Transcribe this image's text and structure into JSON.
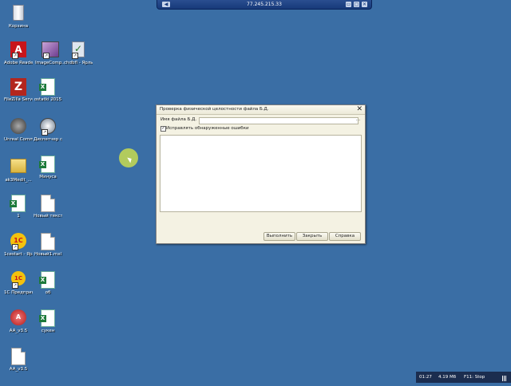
{
  "remote_bar": {
    "host": "77.245.215.33",
    "pin": "◀",
    "min": "▭",
    "restore": "▢",
    "close": "✕"
  },
  "desktop_icons": [
    {
      "label": "Корзина"
    },
    {
      "label": "Adobe Reader 9"
    },
    {
      "label": "ImageComp..."
    },
    {
      "label": "chdbfl - Ярлык"
    },
    {
      "label": "FileZilla Server Interface"
    },
    {
      "label": "ostatki 2015"
    },
    {
      "label": "Unreal Commander"
    },
    {
      "label": "Диспетчер служб у..."
    },
    {
      "label": "ak3Medit_..."
    },
    {
      "label": "Минуса"
    },
    {
      "label": "1"
    },
    {
      "label": "Новый текстов..."
    },
    {
      "label": "1cestart - Ярлык"
    },
    {
      "label": "Новый1.mxl"
    },
    {
      "label": "1С Предприятие"
    },
    {
      "label": "об"
    },
    {
      "label": "AA_v3.5"
    },
    {
      "label": "сукен"
    },
    {
      "label": "AA_v3.5"
    }
  ],
  "dialog": {
    "title": "Проверка физической целостности файла Б.Д.",
    "close": "✕",
    "file_label": "Имя файла Б.Д.",
    "file_value": "",
    "browse": "...",
    "fix_errors_label": "Исправлять обнаруженные ошибки",
    "fix_errors_checked": "✓",
    "buttons": {
      "run": "Выполнить",
      "close": "Закрыть",
      "help": "Справка"
    }
  },
  "status_bar": {
    "time": "01:27",
    "size": "4.19 Мб",
    "hint": "F11: Stop"
  }
}
